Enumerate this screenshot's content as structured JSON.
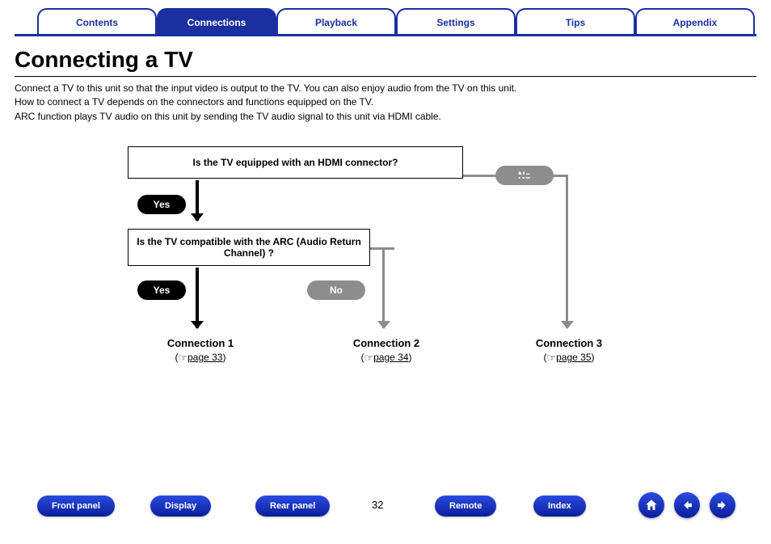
{
  "tabs": {
    "contents": "Contents",
    "connections": "Connections",
    "playback": "Playback",
    "settings": "Settings",
    "tips": "Tips",
    "appendix": "Appendix"
  },
  "title": "Connecting a TV",
  "intro": {
    "l1": "Connect a TV to this unit so that the input video is output to the TV. You can also enjoy audio from the TV on this unit.",
    "l2": "How to connect a TV depends on the connectors and functions equipped on the TV.",
    "l3": "ARC function plays TV audio on this unit by sending the TV audio signal to this unit via HDMI cable."
  },
  "flow": {
    "q1": "Is the TV equipped with an HDMI connector?",
    "q2": "Is the TV compatible with the ARC (Audio Return Channel) ?",
    "yes": "Yes",
    "no": "No",
    "conn1": {
      "title": "Connection 1",
      "ref": "page 33"
    },
    "conn2": {
      "title": "Connection 2",
      "ref": "page 34"
    },
    "conn3": {
      "title": "Connection 3",
      "ref": "page 35"
    }
  },
  "footer": {
    "front_panel": "Front panel",
    "display": "Display",
    "rear_panel": "Rear panel",
    "remote": "Remote",
    "index": "Index",
    "page": "32"
  },
  "icons": {
    "hand": "☞",
    "home": "home-icon",
    "prev": "arrow-left-icon",
    "next": "arrow-right-icon"
  }
}
